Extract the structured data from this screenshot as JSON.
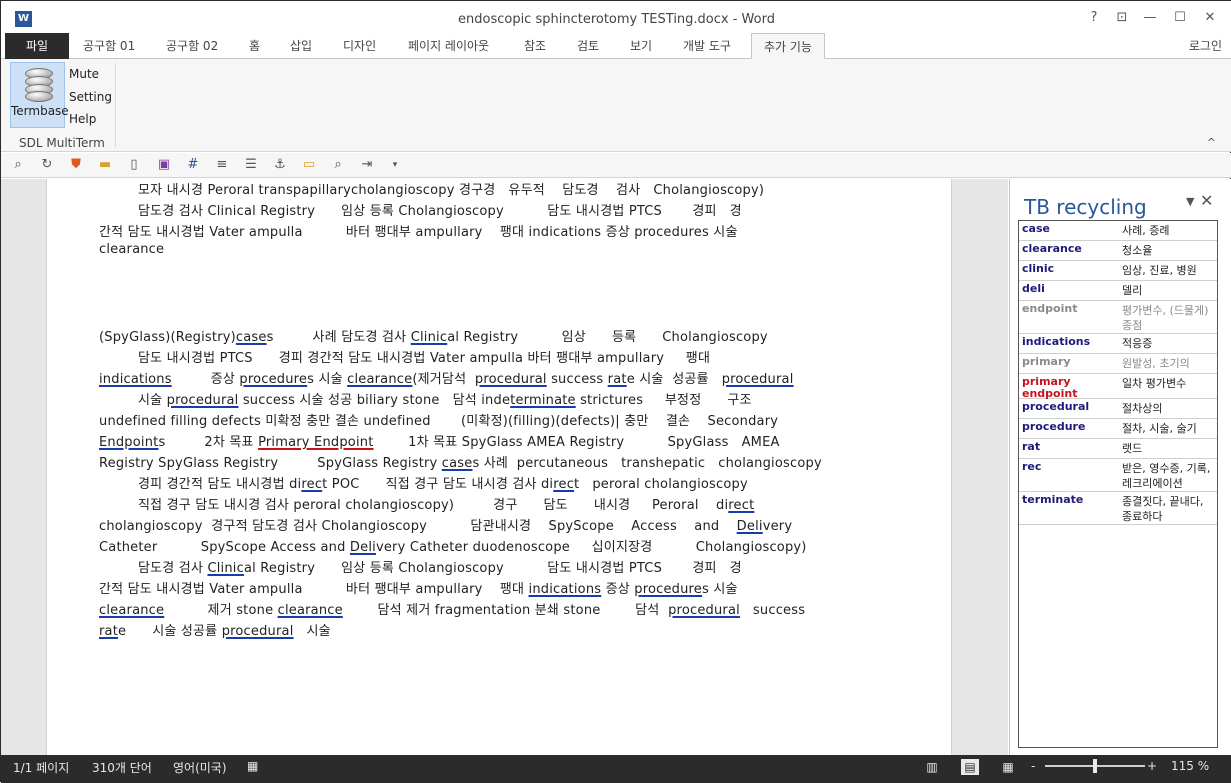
{
  "window": {
    "title": "endoscopic sphincterotomy TESTing.docx - Word",
    "app_icon": "W",
    "help": "?",
    "restore_ribbon": "⊡",
    "minimize": "—",
    "maximize": "☐",
    "close": "✕"
  },
  "tabs": {
    "file": "파일",
    "items": [
      "공구함 01",
      "공구함 02",
      "홈",
      "삽입",
      "디자인",
      "페이지 레이아웃",
      "참조",
      "검토",
      "보기",
      "개발 도구",
      "추가 기능"
    ],
    "login": "로그인"
  },
  "ribbon": {
    "termbase": "Termbase",
    "mute": "Mute",
    "setting": "Setting",
    "help": "Help",
    "group_label": "SDL MultiTerm",
    "collapse": "^"
  },
  "quick_toolbar": {
    "icons": [
      "binoculars-icon",
      "refresh-icon",
      "shield-icon",
      "folder-icon",
      "new-page-icon",
      "save-icon",
      "grid-icon",
      "document-icon",
      "list-icon",
      "anchor-icon",
      "folder-open-icon",
      "find-icon",
      "export-icon",
      "dropdown-icon"
    ]
  },
  "document": {
    "lines": [
      {
        "segments": [
          {
            "t": "         모자 내시경 Peroral transpapillarycholangioscopy 경구경   유두적    담도경    검사   Cholangioscopy)"
          }
        ]
      },
      {
        "segments": [
          {
            "t": "         담도경 검사 Clinical Registry      임상 등록 Cholangioscopy          담도 내시경법 PTCS       경피   경"
          }
        ]
      },
      {
        "segments": [
          {
            "t": "간적 담도 내시경법 Vater ampulla          바터 팽대부 ampullary    팽대 indications 증상 procedures 시술"
          }
        ]
      },
      {
        "segments": [
          {
            "t": "clearance"
          }
        ]
      },
      {
        "segments": [
          {
            "t": "(SpyGlass)(Registry)"
          },
          {
            "t": "case",
            "u": 1
          },
          {
            "t": "s         사례 담도경 검사 "
          },
          {
            "t": "Clinic",
            "u": 1
          },
          {
            "t": "al Registry          임상      등록      Cholangioscopy"
          }
        ]
      },
      {
        "segments": [
          {
            "t": "         담도 내시경법 PTCS      경피 경간적 담도 내시경법 Vater ampulla 바터 팽대부 ampullary     팽대"
          }
        ]
      },
      {
        "segments": [
          {
            "t": "indications",
            "u": 1
          },
          {
            "t": "         증상 "
          },
          {
            "t": "procedure",
            "u": 1
          },
          {
            "t": "s 시술 "
          },
          {
            "t": "clearance",
            "u": 1
          },
          {
            "t": "(제거담석  "
          },
          {
            "t": "procedural",
            "u": 1
          },
          {
            "t": " success "
          },
          {
            "t": "rat",
            "u": 1
          },
          {
            "t": "e 시술  성공률   "
          },
          {
            "t": "procedural",
            "u": 1
          }
        ]
      },
      {
        "segments": [
          {
            "t": "         시술 "
          },
          {
            "t": "procedural",
            "u": 1
          },
          {
            "t": " success 시술 성공 biliary stone   담석 inde"
          },
          {
            "t": "terminate",
            "u": 1
          },
          {
            "t": " strictures     부정정      구조"
          }
        ]
      },
      {
        "segments": [
          {
            "t": "undefined filling defects 미확정 충만 결손 undefined       (미확정)(filling)(defects)| 충만    결손    Secondary"
          }
        ]
      },
      {
        "segments": [
          {
            "t": "Endpoint",
            "u": 1
          },
          {
            "t": "s         2차 목표 "
          },
          {
            "t": "Primary Endpoint",
            "ur": 1
          },
          {
            "t": "        1차 목표 SpyGlass AMEA Registry          SpyGlass   AMEA"
          }
        ]
      },
      {
        "segments": [
          {
            "t": "Registry SpyGlass Registry         SpyGlass Registry "
          },
          {
            "t": "case",
            "u": 1
          },
          {
            "t": "s 사례  percutaneous   transhepatic   cholangioscopy"
          }
        ]
      },
      {
        "segments": [
          {
            "t": "         경피 경간적 담도 내시경법 di"
          },
          {
            "t": "rec",
            "u": 1
          },
          {
            "t": "t POC      직접 경구 담도 내시경 검사 di"
          },
          {
            "t": "rec",
            "u": 1
          },
          {
            "t": "t   peroral cholangioscopy"
          }
        ]
      },
      {
        "segments": [
          {
            "t": "         직접 경구 담도 내시경 검사 peroral cholangioscopy)         경구      담도      내시경     Peroral    di"
          },
          {
            "t": "rect",
            "u": 1
          }
        ]
      },
      {
        "segments": [
          {
            "t": "cholangioscopy  경구적 담도경 검사 Cholangioscopy          담관내시경    SpyScope    Access    and    "
          },
          {
            "t": "Deli",
            "u": 1
          },
          {
            "t": "very"
          }
        ]
      },
      {
        "segments": [
          {
            "t": "Catheter          SpyScope Access and "
          },
          {
            "t": "Deli",
            "u": 1
          },
          {
            "t": "very Catheter duodenoscope     십이지장경          Cholangioscopy)"
          }
        ]
      },
      {
        "segments": [
          {
            "t": "         담도경 검사 "
          },
          {
            "t": "Clinic",
            "u": 1
          },
          {
            "t": "al Registry      임상 등록 Cholangioscopy          담도 내시경법 PTCS       경피   경"
          }
        ]
      },
      {
        "segments": [
          {
            "t": "간적 담도 내시경법 Vater ampulla          바터 팽대부 ampullary    팽대 "
          },
          {
            "t": "indications",
            "u": 1
          },
          {
            "t": " 증상 "
          },
          {
            "t": "procedure",
            "u": 1
          },
          {
            "t": "s 시술"
          }
        ]
      },
      {
        "segments": [
          {
            "t": "clearance",
            "u": 1
          },
          {
            "t": "          제거 stone "
          },
          {
            "t": "clearance",
            "u": 1
          },
          {
            "t": "        담석 제거 fragmentation 분쇄 stone        담석  "
          },
          {
            "t": "procedural",
            "u": 1
          },
          {
            "t": "   success"
          }
        ]
      },
      {
        "segments": [
          {
            "t": "rat",
            "u": 1
          },
          {
            "t": "e      시술 성공률 "
          },
          {
            "t": "procedural",
            "u": 1
          },
          {
            "t": "   시술"
          }
        ]
      }
    ]
  },
  "pane": {
    "title": "TB recycling",
    "dropdown": "▼",
    "close": "✕",
    "rows": [
      {
        "term": "case",
        "translation": "사례, 증례",
        "style": "normal"
      },
      {
        "term": "clearance",
        "translation": "청소율",
        "style": "normal"
      },
      {
        "term": "clinic",
        "translation": "임상, 진료, 병원",
        "style": "normal"
      },
      {
        "term": "deli",
        "translation": "델리",
        "style": "normal"
      },
      {
        "term": "endpoint",
        "translation": "평가변수, (드물게)종점",
        "style": "gray"
      },
      {
        "term": "indications",
        "translation": "적응증",
        "style": "normal"
      },
      {
        "term": "primary",
        "translation": "원발성, 초기의",
        "style": "gray"
      },
      {
        "term": "primary endpoint",
        "translation": "일차 평가변수",
        "style": "red"
      },
      {
        "term": "procedural",
        "translation": "절차상의",
        "style": "normal"
      },
      {
        "term": "procedure",
        "translation": "절차, 시술, 술기",
        "style": "normal"
      },
      {
        "term": "rat",
        "translation": "랫드",
        "style": "normal"
      },
      {
        "term": "rec",
        "translation": "받은, 영수증, 기록, 레크리에이션",
        "style": "normal"
      },
      {
        "term": "terminate",
        "translation": "종결짓다, 끝내다, 종료하다",
        "style": "normal"
      }
    ]
  },
  "status": {
    "page": "1/1 페이지",
    "words": "310개 단어",
    "language": "영어(미국)",
    "zoom_minus": "-",
    "zoom_plus": "+",
    "zoom": "115 %",
    "zoom_level_percent": 115
  }
}
